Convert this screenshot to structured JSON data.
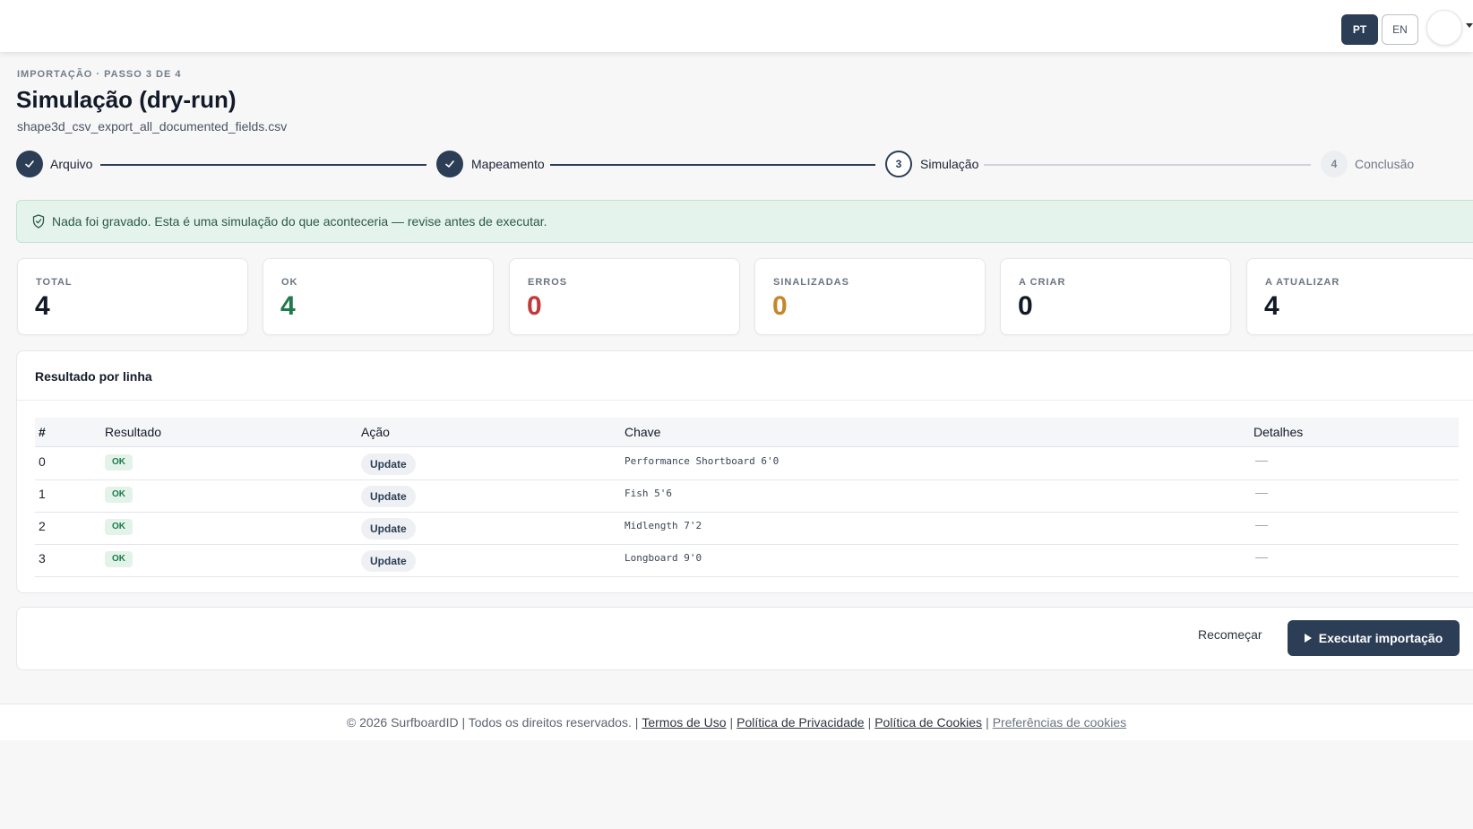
{
  "header": {
    "lang_pt": "PT",
    "lang_en": "EN"
  },
  "page": {
    "eyebrow": "IMPORTAÇÃO · PASSO 3 DE 4",
    "title": "Simulação (dry-run)",
    "filename": "shape3d_csv_export_all_documented_fields.csv"
  },
  "steps": [
    {
      "label": "Arquivo",
      "number": "1",
      "state": "done"
    },
    {
      "label": "Mapeamento",
      "number": "2",
      "state": "done"
    },
    {
      "label": "Simulação",
      "number": "3",
      "state": "current"
    },
    {
      "label": "Conclusão",
      "number": "4",
      "state": "todo"
    }
  ],
  "alert": {
    "text": "Nada foi gravado. Esta é uma simulação do que aconteceria — revise antes de executar.",
    "icon": "shield-icon"
  },
  "stats": [
    {
      "label": "TOTAL",
      "value": "4",
      "color": "#121a28"
    },
    {
      "label": "OK",
      "value": "4",
      "color": "#1f7a4d"
    },
    {
      "label": "ERROS",
      "value": "0",
      "color": "#c0393b"
    },
    {
      "label": "SINALIZADAS",
      "value": "0",
      "color": "#c5862a"
    },
    {
      "label": "A CRIAR",
      "value": "0",
      "color": "#121a28"
    },
    {
      "label": "A ATUALIZAR",
      "value": "4",
      "color": "#121a28"
    }
  ],
  "results": {
    "title": "Resultado por linha",
    "columns": [
      "#",
      "Resultado",
      "Ação",
      "Chave",
      "Detalhes"
    ],
    "rows": [
      {
        "num": "0",
        "result": "OK",
        "action": "Update",
        "key": "Performance Shortboard 6'0",
        "details": "—"
      },
      {
        "num": "1",
        "result": "OK",
        "action": "Update",
        "key": "Fish 5'6",
        "details": "—"
      },
      {
        "num": "2",
        "result": "OK",
        "action": "Update",
        "key": "Midlength 7'2",
        "details": "—"
      },
      {
        "num": "3",
        "result": "OK",
        "action": "Update",
        "key": "Longboard 9'0",
        "details": "—"
      }
    ]
  },
  "actions": {
    "restart_label": "Recomeçar",
    "run_label": "Executar importação"
  },
  "footer": {
    "copyright": "© 2026 SurfboardID | Todos os direitos reservados. |",
    "terms": "Termos de Uso",
    "privacy": "Política de Privacidade",
    "cookies": "Política de Cookies",
    "cookie_prefs": "Preferências de cookies",
    "separator": "|"
  },
  "colors": {
    "primary": "#2c3e56",
    "success": "#1f7a4d",
    "error": "#c0393b",
    "warning": "#c5862a"
  }
}
